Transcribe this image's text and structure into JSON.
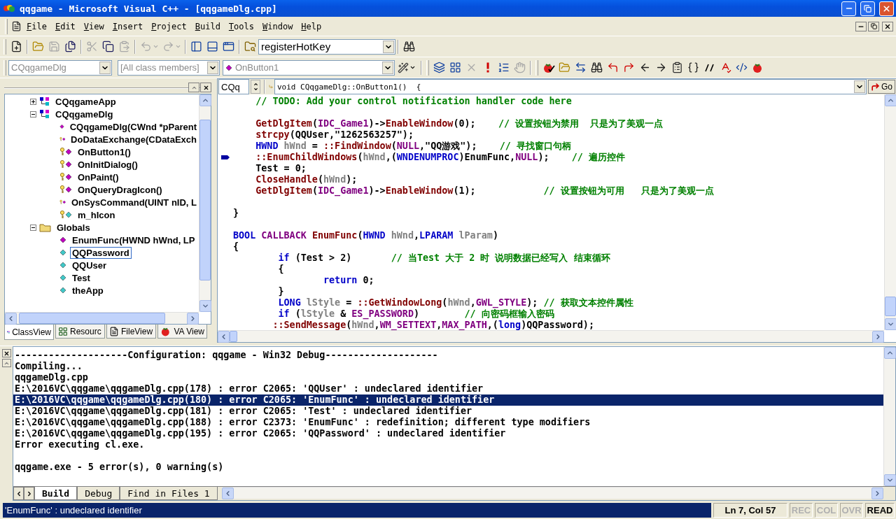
{
  "window": {
    "title": "qqgame - Microsoft Visual C++ - [qqgameDlg.cpp]"
  },
  "menu": [
    {
      "label": "File"
    },
    {
      "label": "Edit"
    },
    {
      "label": "View"
    },
    {
      "label": "Insert"
    },
    {
      "label": "Project"
    },
    {
      "label": "Build"
    },
    {
      "label": "Tools"
    },
    {
      "label": "Window"
    },
    {
      "label": "Help"
    }
  ],
  "toolbar_standard": [
    {
      "kind": "new",
      "disabled": false
    },
    {
      "kind": "separator"
    },
    {
      "kind": "open",
      "disabled": false
    },
    {
      "kind": "save",
      "disabled": true
    },
    {
      "kind": "saveall",
      "disabled": false
    },
    {
      "kind": "separator"
    },
    {
      "kind": "cut",
      "disabled": true
    },
    {
      "kind": "copy",
      "disabled": false
    },
    {
      "kind": "paste",
      "disabled": true
    },
    {
      "kind": "separator"
    },
    {
      "kind": "undo",
      "disabled": true
    },
    {
      "kind": "redo",
      "disabled": true
    },
    {
      "kind": "separator"
    },
    {
      "kind": "workspace",
      "disabled": false
    },
    {
      "kind": "output",
      "disabled": false
    },
    {
      "kind": "windows",
      "disabled": false
    },
    {
      "kind": "separator"
    },
    {
      "kind": "findfiles",
      "disabled": false
    },
    {
      "kind": "combo",
      "value": "registerHotKey"
    },
    {
      "kind": "separator"
    },
    {
      "kind": "find",
      "disabled": false
    }
  ],
  "wizard_bar": {
    "class": "CQqgameDlg",
    "filter": "[All class members]",
    "member": "OnButton1"
  },
  "toolbar_build": [
    {
      "kind": "compile",
      "disabled": false
    },
    {
      "kind": "build",
      "disabled": false
    },
    {
      "kind": "stop",
      "disabled": true
    },
    {
      "kind": "execute",
      "disabled": false
    },
    {
      "kind": "breakpoints",
      "disabled": false
    },
    {
      "kind": "hand",
      "disabled": true
    }
  ],
  "toolbar_va": [
    {
      "kind": "vacheck",
      "disabled": false
    },
    {
      "kind": "open",
      "disabled": false
    },
    {
      "kind": "swap",
      "disabled": false
    },
    {
      "kind": "find",
      "disabled": false
    },
    {
      "kind": "bmprev",
      "disabled": false
    },
    {
      "kind": "bmnext",
      "disabled": false
    },
    {
      "kind": "back",
      "disabled": false
    },
    {
      "kind": "forward",
      "disabled": false
    },
    {
      "kind": "pastemulti",
      "disabled": false
    },
    {
      "kind": "braces",
      "disabled": false
    },
    {
      "kind": "comment",
      "disabled": false
    },
    {
      "kind": "spell",
      "disabled": false
    },
    {
      "kind": "codejump",
      "disabled": false
    },
    {
      "kind": "tomato",
      "disabled": false
    }
  ],
  "class_tree": [
    {
      "label": "CQqgameApp",
      "kind": "class",
      "expanded": false,
      "selected": false
    },
    {
      "label": "CQqgameDlg",
      "kind": "class",
      "expanded": true,
      "selected": false,
      "children": [
        {
          "label": "CQqgameDlg(CWnd *pParent",
          "kind": "method",
          "selected": false
        },
        {
          "label": "DoDataExchange(CDataExch",
          "kind": "protected_method",
          "selected": false
        },
        {
          "label": "OnButton1()",
          "kind": "protected_method",
          "selected": false
        },
        {
          "label": "OnInitDialog()",
          "kind": "protected_method",
          "selected": false
        },
        {
          "label": "OnPaint()",
          "kind": "protected_method",
          "selected": false
        },
        {
          "label": "OnQueryDragIcon()",
          "kind": "protected_method",
          "selected": false
        },
        {
          "label": "OnSysCommand(UINT nID, L",
          "kind": "protected_method",
          "selected": false
        },
        {
          "label": "m_hIcon",
          "kind": "protected_variable",
          "selected": false
        }
      ]
    },
    {
      "label": "Globals",
      "kind": "folder",
      "expanded": true,
      "selected": false,
      "children": [
        {
          "label": "EnumFunc(HWND hWnd, LP",
          "kind": "method",
          "selected": false
        },
        {
          "label": "QQPassword",
          "kind": "variable",
          "selected": true
        },
        {
          "label": "QQUser",
          "kind": "variable",
          "selected": false
        },
        {
          "label": "Test",
          "kind": "variable",
          "selected": false
        },
        {
          "label": "theApp",
          "kind": "variable",
          "selected": false
        }
      ]
    }
  ],
  "workspace_tabs": [
    {
      "label": "ClassView",
      "kind": "class",
      "selected": true
    },
    {
      "label": "Resourc",
      "kind": "resource",
      "selected": false
    },
    {
      "label": "FileView",
      "kind": "file",
      "selected": false
    },
    {
      "label": "VA View",
      "kind": "va",
      "selected": false
    }
  ],
  "editor_nav": {
    "scope": "CQq",
    "function": "void CQqgameDlg::OnButton1()  {",
    "go": "Go"
  },
  "code_lines": [
    {
      "current": false,
      "segments": [
        {
          "kind": "comment",
          "text": "    // TODO: Add your control notification handler code here"
        }
      ]
    },
    {
      "current": false
    },
    {
      "current": false,
      "segments": [
        {
          "kind": "function",
          "text": "    GetDlgItem"
        },
        {
          "kind": "plain",
          "text": "("
        },
        {
          "kind": "macro",
          "text": "IDC_Game1"
        },
        {
          "kind": "plain",
          "text": ")->"
        },
        {
          "kind": "function",
          "text": "EnableWindow"
        },
        {
          "kind": "plain",
          "text": "(0);    "
        },
        {
          "kind": "comment",
          "text": "// 设置按钮为禁用  只是为了美观一点"
        }
      ]
    },
    {
      "current": false,
      "segments": [
        {
          "kind": "function",
          "text": "    strcpy"
        },
        {
          "kind": "plain",
          "text": "(QQUser,\"1262563257\");"
        }
      ]
    },
    {
      "current": false,
      "segments": [
        {
          "kind": "keyword",
          "text": "    HWND "
        },
        {
          "kind": "local",
          "text": "hWnd"
        },
        {
          "kind": "plain",
          "text": " = "
        },
        {
          "kind": "function",
          "text": "::FindWindow"
        },
        {
          "kind": "plain",
          "text": "("
        },
        {
          "kind": "macro",
          "text": "NULL"
        },
        {
          "kind": "plain",
          "text": ",\"QQ游戏\");    "
        },
        {
          "kind": "comment",
          "text": "// 寻找窗口句柄"
        }
      ]
    },
    {
      "current": true,
      "segments": [
        {
          "kind": "function",
          "text": "    ::EnumChildWindows"
        },
        {
          "kind": "plain",
          "text": "("
        },
        {
          "kind": "local",
          "text": "hWnd"
        },
        {
          "kind": "plain",
          "text": ",("
        },
        {
          "kind": "keyword",
          "text": "WNDENUMPROC"
        },
        {
          "kind": "plain",
          "text": ")EnumFunc,"
        },
        {
          "kind": "macro",
          "text": "NULL"
        },
        {
          "kind": "plain",
          "text": ");    "
        },
        {
          "kind": "comment",
          "text": "// 遍历控件"
        }
      ]
    },
    {
      "current": false,
      "segments": [
        {
          "kind": "plain",
          "text": "    Test = 0;"
        }
      ]
    },
    {
      "current": false,
      "segments": [
        {
          "kind": "function",
          "text": "    CloseHandle"
        },
        {
          "kind": "plain",
          "text": "("
        },
        {
          "kind": "local",
          "text": "hWnd"
        },
        {
          "kind": "plain",
          "text": ");"
        }
      ]
    },
    {
      "current": false,
      "segments": [
        {
          "kind": "function",
          "text": "    GetDlgItem"
        },
        {
          "kind": "plain",
          "text": "("
        },
        {
          "kind": "macro",
          "text": "IDC_Game1"
        },
        {
          "kind": "plain",
          "text": ")->"
        },
        {
          "kind": "function",
          "text": "EnableWindow"
        },
        {
          "kind": "plain",
          "text": "(1);            "
        },
        {
          "kind": "comment",
          "text": "// 设置按钮为可用   只是为了美观一点"
        }
      ]
    },
    {
      "current": false
    },
    {
      "current": false,
      "segments": [
        {
          "kind": "plain",
          "text": "}"
        }
      ]
    },
    {
      "current": false
    },
    {
      "current": false,
      "segments": [
        {
          "kind": "keyword",
          "text": "BOOL "
        },
        {
          "kind": "macro",
          "text": "CALLBACK "
        },
        {
          "kind": "function",
          "text": "EnumFunc"
        },
        {
          "kind": "plain",
          "text": "("
        },
        {
          "kind": "keyword",
          "text": "HWND "
        },
        {
          "kind": "local",
          "text": "hWnd"
        },
        {
          "kind": "plain",
          "text": ","
        },
        {
          "kind": "keyword",
          "text": "LPARAM "
        },
        {
          "kind": "local",
          "text": "lParam"
        },
        {
          "kind": "plain",
          "text": ")"
        }
      ]
    },
    {
      "current": false,
      "segments": [
        {
          "kind": "plain",
          "text": "{"
        }
      ]
    },
    {
      "current": false,
      "segments": [
        {
          "kind": "keyword",
          "text": "        if"
        },
        {
          "kind": "plain",
          "text": " (Test > 2)       "
        },
        {
          "kind": "comment",
          "text": "// 当Test 大于 2 时 说明数据已经写入 结束循环"
        }
      ]
    },
    {
      "current": false,
      "segments": [
        {
          "kind": "plain",
          "text": "        {"
        }
      ]
    },
    {
      "current": false,
      "segments": [
        {
          "kind": "keyword",
          "text": "                return"
        },
        {
          "kind": "plain",
          "text": " 0;"
        }
      ]
    },
    {
      "current": false,
      "segments": [
        {
          "kind": "plain",
          "text": "        }"
        }
      ]
    },
    {
      "current": false,
      "segments": [
        {
          "kind": "keyword",
          "text": "        LONG "
        },
        {
          "kind": "local",
          "text": "lStyle"
        },
        {
          "kind": "plain",
          "text": " = "
        },
        {
          "kind": "function",
          "text": "::GetWindowLong"
        },
        {
          "kind": "plain",
          "text": "("
        },
        {
          "kind": "local",
          "text": "hWnd"
        },
        {
          "kind": "plain",
          "text": ","
        },
        {
          "kind": "macro",
          "text": "GWL_STYLE"
        },
        {
          "kind": "plain",
          "text": "); "
        },
        {
          "kind": "comment",
          "text": "// 获取文本控件属性"
        }
      ]
    },
    {
      "current": false,
      "segments": [
        {
          "kind": "keyword",
          "text": "        if"
        },
        {
          "kind": "plain",
          "text": " ("
        },
        {
          "kind": "local",
          "text": "lStyle"
        },
        {
          "kind": "plain",
          "text": " & "
        },
        {
          "kind": "macro",
          "text": "ES_PASSWORD"
        },
        {
          "kind": "plain",
          "text": ")        "
        },
        {
          "kind": "comment",
          "text": "// 向密码框输入密码"
        }
      ]
    },
    {
      "current": false,
      "segments": [
        {
          "kind": "function",
          "text": "       ::SendMessage"
        },
        {
          "kind": "plain",
          "text": "("
        },
        {
          "kind": "local",
          "text": "hWnd"
        },
        {
          "kind": "plain",
          "text": ","
        },
        {
          "kind": "macro",
          "text": "WM_SETTEXT"
        },
        {
          "kind": "plain",
          "text": ","
        },
        {
          "kind": "macro",
          "text": "MAX_PATH"
        },
        {
          "kind": "plain",
          "text": ",("
        },
        {
          "kind": "keyword",
          "text": "long"
        },
        {
          "kind": "plain",
          "text": ")QQPassword);"
        }
      ]
    }
  ],
  "output_lines": [
    {
      "text": "--------------------Configuration: qqgame - Win32 Debug--------------------",
      "selected": false
    },
    {
      "text": "Compiling...",
      "selected": false
    },
    {
      "text": "qqgameDlg.cpp",
      "selected": false
    },
    {
      "text": "E:\\2016VC\\qqgame\\qqgameDlg.cpp(178) : error C2065: 'QQUser' : undeclared identifier",
      "selected": false
    },
    {
      "text": "E:\\2016VC\\qqgame\\qqgameDlg.cpp(180) : error C2065: 'EnumFunc' : undeclared identifier",
      "selected": true
    },
    {
      "text": "E:\\2016VC\\qqgame\\qqgameDlg.cpp(181) : error C2065: 'Test' : undeclared identifier",
      "selected": false
    },
    {
      "text": "E:\\2016VC\\qqgame\\qqgameDlg.cpp(188) : error C2373: 'EnumFunc' : redefinition; different type modifiers",
      "selected": false
    },
    {
      "text": "E:\\2016VC\\qqgame\\qqgameDlg.cpp(195) : error C2065: 'QQPassword' : undeclared identifier",
      "selected": false
    },
    {
      "text": "Error executing cl.exe.",
      "selected": false
    },
    {
      "selected": false
    },
    {
      "text": "qqgame.exe - 5 error(s), 0 warning(s)",
      "selected": false
    }
  ],
  "output_tabs": [
    {
      "label": "Build",
      "selected": true
    },
    {
      "label": "Debug",
      "selected": false
    },
    {
      "label": "Find in Files 1",
      "selected": false
    }
  ],
  "status_bar": {
    "message": "'EnumFunc' : undeclared identifier",
    "position": "Ln 7, Col 57",
    "indicators": [
      {
        "label": "REC",
        "on": false
      },
      {
        "label": "COL",
        "on": false
      },
      {
        "label": "OVR",
        "on": false
      },
      {
        "label": "READ",
        "on": true
      }
    ]
  }
}
